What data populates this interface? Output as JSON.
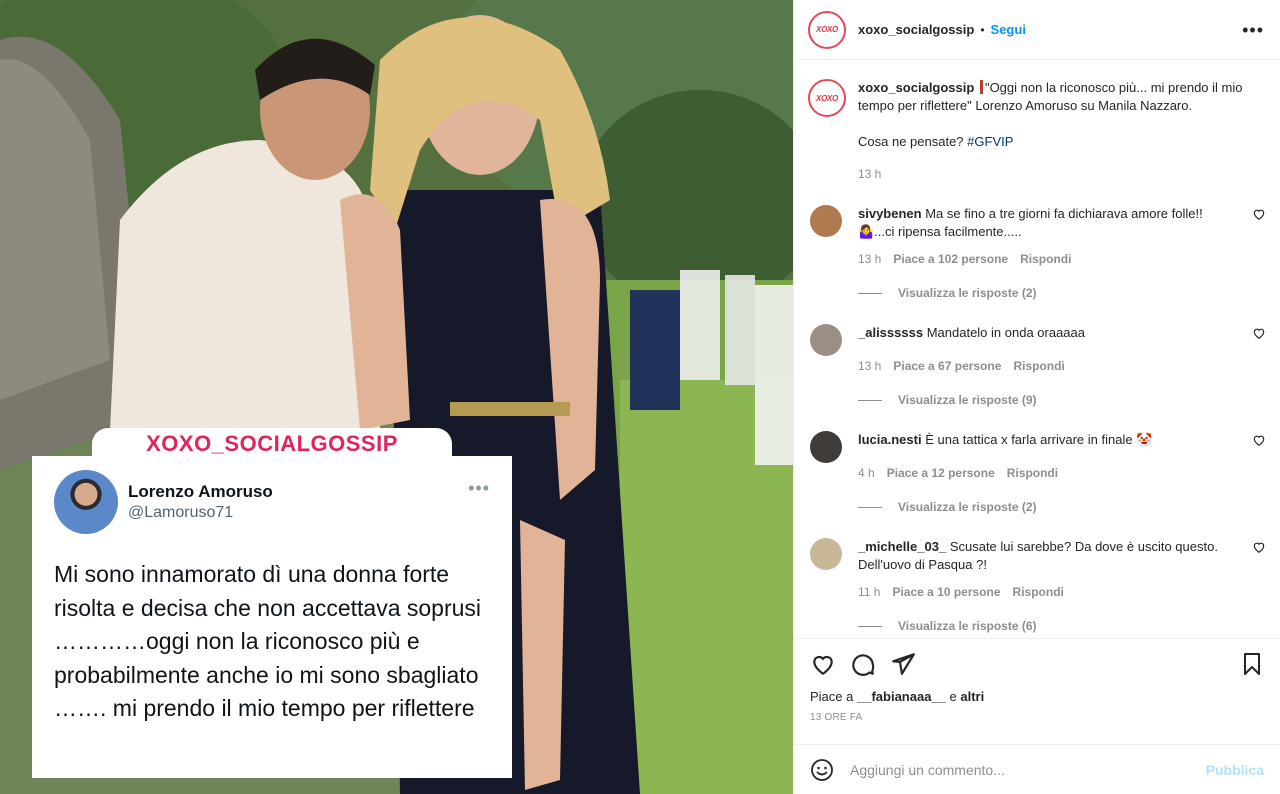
{
  "post": {
    "username": "xoxo_socialgossip",
    "separator": "•",
    "follow_label": "Segui",
    "more_icon": "more-horizontal-icon",
    "avatar_text": "XOXO",
    "image": {
      "brand_banner": "XOXO_SOCIALGOSSIP",
      "tweet": {
        "name": "Lorenzo Amoruso",
        "handle": "@Lamoruso71",
        "more": "•••",
        "text": "Mi sono innamorato dì una donna forte risolta e decisa che non accettava soprusi …………oggi non la riconosco più e probabilmente anche io mi sono sbagliato ……. mi prendo il mio tempo per riflettere"
      }
    }
  },
  "caption": {
    "username": "xoxo_socialgossip",
    "text": "\"Oggi non la riconosco più... mi prendo il mio tempo per riflettere\" Lorenzo Amoruso su Manila Nazzaro.",
    "text2": "Cosa ne pensate?",
    "hashtag": "#GFVIP",
    "time": "13 h"
  },
  "comments": [
    {
      "username": "sivybenen",
      "text": "Ma se fino a tre giorni fa dichiarava amore folle!! 🤷‍♀️...ci ripensa facilmente.....",
      "time": "13 h",
      "likes": "Piace a 102 persone",
      "reply": "Rispondi",
      "view_replies": "Visualizza le risposte (2)",
      "avatar_color": "#b07a4e"
    },
    {
      "username": "_alissssss",
      "text": "Mandatelo in onda oraaaaa",
      "time": "13 h",
      "likes": "Piace a 67 persone",
      "reply": "Rispondi",
      "view_replies": "Visualizza le risposte (9)",
      "avatar_color": "#9a8f82"
    },
    {
      "username": "lucia.nesti",
      "text": "È una tattica x farla arrivare in finale 🤡",
      "time": "4 h",
      "likes": "Piace a 12 persone",
      "reply": "Rispondi",
      "view_replies": "Visualizza le risposte (2)",
      "avatar_color": "#3e3b38"
    },
    {
      "username": "_michelle_03_",
      "text": "Scusate lui sarebbe? Da dove è uscito questo. Dell'uovo di Pasqua ?!",
      "time": "11 h",
      "likes": "Piace a 10 persone",
      "reply": "Rispondi",
      "view_replies": "Visualizza le risposte (6)",
      "avatar_color": "#c9b79a"
    }
  ],
  "actions": {
    "icons": [
      "heart-icon",
      "comment-icon",
      "share-icon",
      "bookmark-icon"
    ],
    "likes_prefix": "Piace a",
    "likes_user": "__fabianaaa__",
    "likes_and": "e",
    "likes_others": "altri",
    "ago": "13 ORE FA"
  },
  "add_comment": {
    "placeholder": "Aggiungi un commento...",
    "publish_label": "Pubblica",
    "emoji_icon": "smile-icon"
  }
}
